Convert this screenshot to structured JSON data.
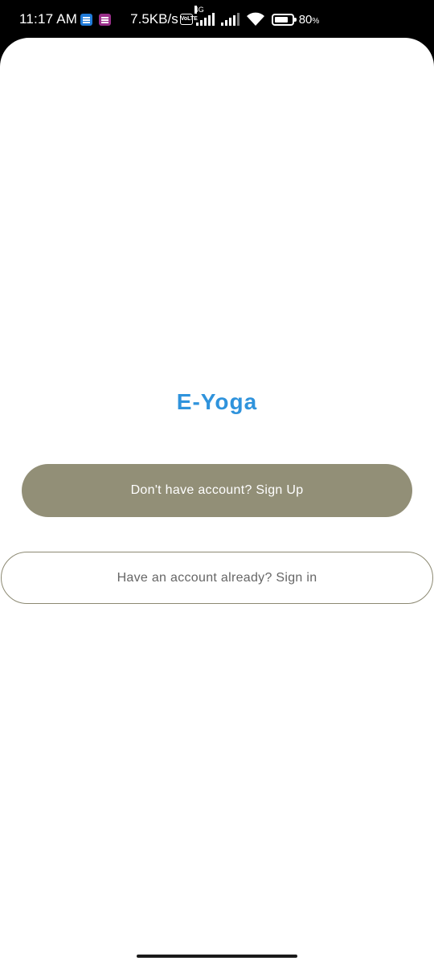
{
  "status_bar": {
    "time": "11:17 AM",
    "network_speed": "7.5KB/s",
    "volte_label": "Vo LTE",
    "network_type": "4G",
    "battery_percent": "80",
    "battery_unit": "%",
    "battery_level": 0.8,
    "icons": [
      "notification-app-icon",
      "notification-lte-icon",
      "volte-icon",
      "signal-icon",
      "signal-icon",
      "wifi-icon",
      "battery-icon"
    ]
  },
  "app": {
    "title": "E-Yoga",
    "signup_label": "Don't have account? Sign Up",
    "signin_label": "Have an account already? Sign in"
  },
  "colors": {
    "title": "#2f93dc",
    "primary_button": "#928f77",
    "outline_button_border": "#8c8972",
    "background": "#ffffff"
  }
}
